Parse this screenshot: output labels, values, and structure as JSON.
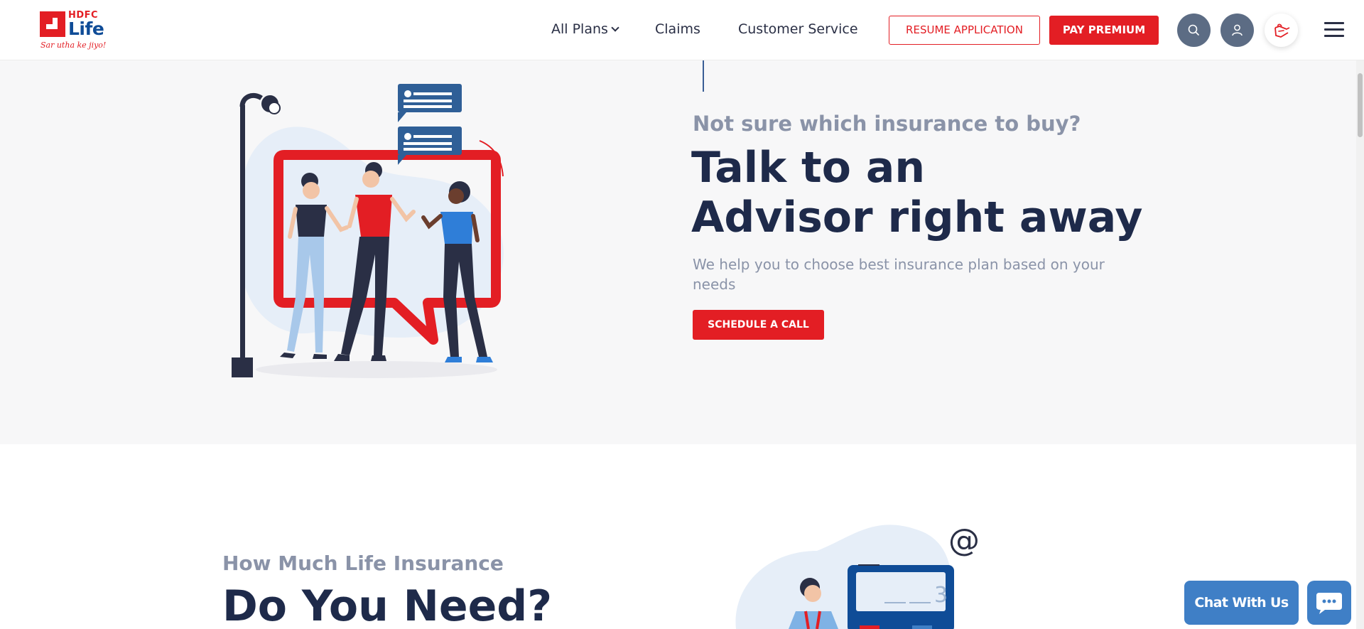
{
  "header": {
    "logo": {
      "brand_top": "HDFC",
      "brand_main": "Life",
      "tagline": "Sar utha ke jiyo!"
    },
    "nav": {
      "all_plans": "All Plans",
      "claims": "Claims",
      "customer_service": "Customer Service"
    },
    "resume_label": "RESUME APPLICATION",
    "pay_label": "PAY PREMIUM",
    "icons": [
      "search-icon",
      "user-icon",
      "hand-heart-icon",
      "hamburger-menu-icon"
    ]
  },
  "advisor": {
    "subtitle": "Not sure which insurance to buy?",
    "title_line1": "Talk to an",
    "title_line2": "Advisor right away",
    "description": "We help you to choose best insurance plan based on your needs",
    "cta": "SCHEDULE A CALL"
  },
  "how_much": {
    "subtitle": "How Much Life Insurance",
    "title": "Do You Need?",
    "calculator_display": "3"
  },
  "chat": {
    "label": "Chat With Us"
  },
  "colors": {
    "brand_red": "#e31e24",
    "brand_blue": "#0f4c97",
    "navy_text": "#1e2a4a",
    "muted_text": "#8a93a8",
    "section_bg": "#f7f7f8",
    "chat_blue": "#3f7fc6"
  }
}
